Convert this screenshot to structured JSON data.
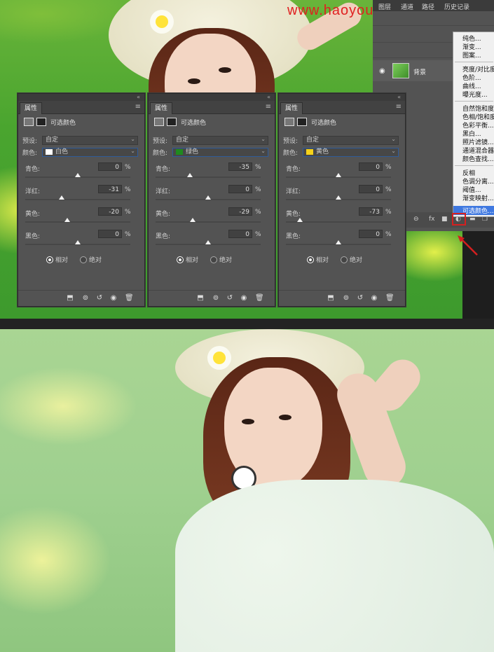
{
  "watermark": "www.haoyouzhishuai.com",
  "layers_panel": {
    "tabs": [
      "图层",
      "通道",
      "路径",
      "历史记录"
    ],
    "layer_name": "背景"
  },
  "adjust_menu": {
    "items": [
      "纯色...",
      "渐变...",
      "图案...",
      "亮度/对比度...",
      "色阶...",
      "曲线...",
      "曝光度...",
      "自然饱和度...",
      "色相/饱和度...",
      "色彩平衡...",
      "黑白...",
      "照片滤镜...",
      "通道混合器...",
      "颜色查找...",
      "反相",
      "色调分离...",
      "阈值...",
      "渐变映射...",
      "可选颜色..."
    ],
    "highlighted": "可选颜色..."
  },
  "panels": [
    {
      "tab": "属性",
      "title": "可选颜色",
      "preset_label": "预设:",
      "preset_value": "自定",
      "color_label": "颜色:",
      "color_name": "白色",
      "color_swatch": "#ffffff",
      "sliders": [
        {
          "label": "青色:",
          "value": "0",
          "fraction": 0.5
        },
        {
          "label": "洋红:",
          "value": "-31",
          "fraction": 0.345
        },
        {
          "label": "黄色:",
          "value": "-20",
          "fraction": 0.4
        },
        {
          "label": "黑色:",
          "value": "0",
          "fraction": 0.5
        }
      ],
      "relative": "相对",
      "absolute": "绝对",
      "mode": "relative"
    },
    {
      "tab": "属性",
      "title": "可选颜色",
      "preset_label": "预设:",
      "preset_value": "自定",
      "color_label": "颜色:",
      "color_name": "绿色",
      "color_swatch": "#1f8a1f",
      "sliders": [
        {
          "label": "青色:",
          "value": "-35",
          "fraction": 0.325
        },
        {
          "label": "洋红:",
          "value": "0",
          "fraction": 0.5
        },
        {
          "label": "黄色:",
          "value": "-29",
          "fraction": 0.355
        },
        {
          "label": "黑色:",
          "value": "0",
          "fraction": 0.5
        }
      ],
      "relative": "相对",
      "absolute": "绝对",
      "mode": "relative"
    },
    {
      "tab": "属性",
      "title": "可选颜色",
      "preset_label": "预设:",
      "preset_value": "自定",
      "color_label": "颜色:",
      "color_name": "黄色",
      "color_swatch": "#f5d21a",
      "sliders": [
        {
          "label": "青色:",
          "value": "0",
          "fraction": 0.5
        },
        {
          "label": "洋红:",
          "value": "0",
          "fraction": 0.5
        },
        {
          "label": "黄色:",
          "value": "-73",
          "fraction": 0.135
        },
        {
          "label": "黑色:",
          "value": "0",
          "fraction": 0.5
        }
      ],
      "relative": "相对",
      "absolute": "绝对",
      "mode": "relative"
    }
  ],
  "percent_sign": "%"
}
